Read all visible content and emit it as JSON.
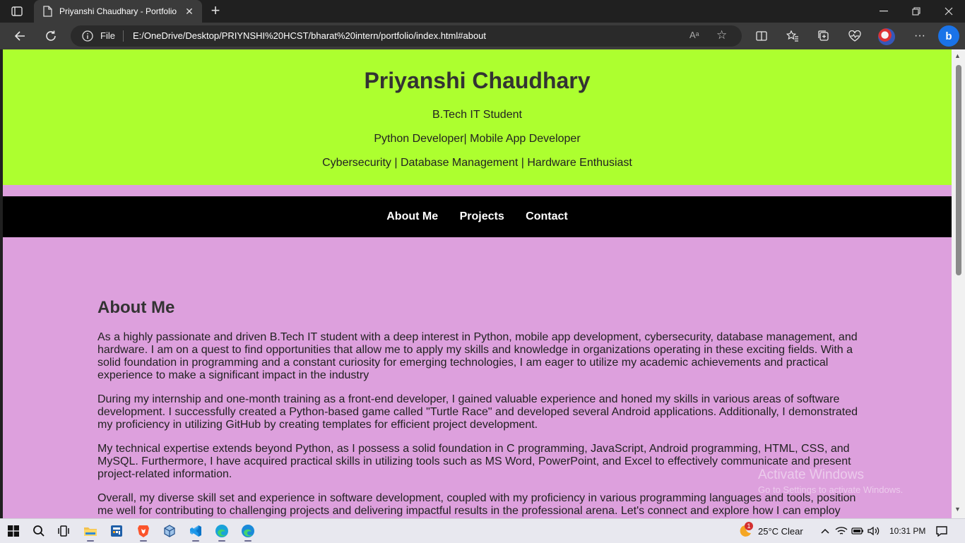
{
  "browser": {
    "tab_title": "Priyanshi Chaudhary - Portfolio",
    "tab_close": "✕",
    "new_tab": "+",
    "address_scheme": "File",
    "url": "E:/OneDrive/Desktop/PRIYNSHI%20HCST/bharat%20intern/portfolio/index.html#about",
    "read_aloud": "Aᵃ",
    "more": "···"
  },
  "page": {
    "name": "Priyanshi Chaudhary",
    "taglines": [
      "B.Tech IT Student",
      "Python Developer| Mobile App Developer",
      "Cybersecurity | Database Management | Hardware Enthusiast"
    ],
    "nav": [
      "About Me",
      "Projects",
      "Contact"
    ],
    "about": {
      "heading": "About Me",
      "paragraphs": [
        "As a highly passionate and driven B.Tech IT student with a deep interest in Python, mobile app development, cybersecurity, database management, and hardware. I am on a quest to find opportunities that allow me to apply my skills and knowledge in organizations operating in these exciting fields. With a solid foundation in programming and a constant curiosity for emerging technologies, I am eager to utilize my academic achievements and practical experience to make a significant impact in the industry",
        "During my internship and one-month training as a front-end developer, I gained valuable experience and honed my skills in various areas of software development. I successfully created a Python-based game called \"Turtle Race\" and developed several Android applications. Additionally, I demonstrated my proficiency in utilizing GitHub by creating templates for efficient project development.",
        "My technical expertise extends beyond Python, as I possess a solid foundation in C programming, JavaScript, Android programming, HTML, CSS, and MySQL. Furthermore, I have acquired practical skills in utilizing tools such as MS Word, PowerPoint, and Excel to effectively communicate and present project-related information.",
        "Overall, my diverse skill set and experience in software development, coupled with my proficiency in various programming languages and tools, position me well for contributing to challenging projects and delivering impactful results in the professional arena. Let's connect and explore how I can employ"
      ]
    }
  },
  "watermark": {
    "line1": "Activate Windows",
    "line2": "Go to Settings to activate Windows."
  },
  "taskbar": {
    "weather_badge": "1",
    "weather": "25°C  Clear",
    "time": "10:31 PM"
  },
  "colors": {
    "header_bg": "#adff2f",
    "page_bg": "#dda0dd",
    "nav_bg": "#000000"
  }
}
